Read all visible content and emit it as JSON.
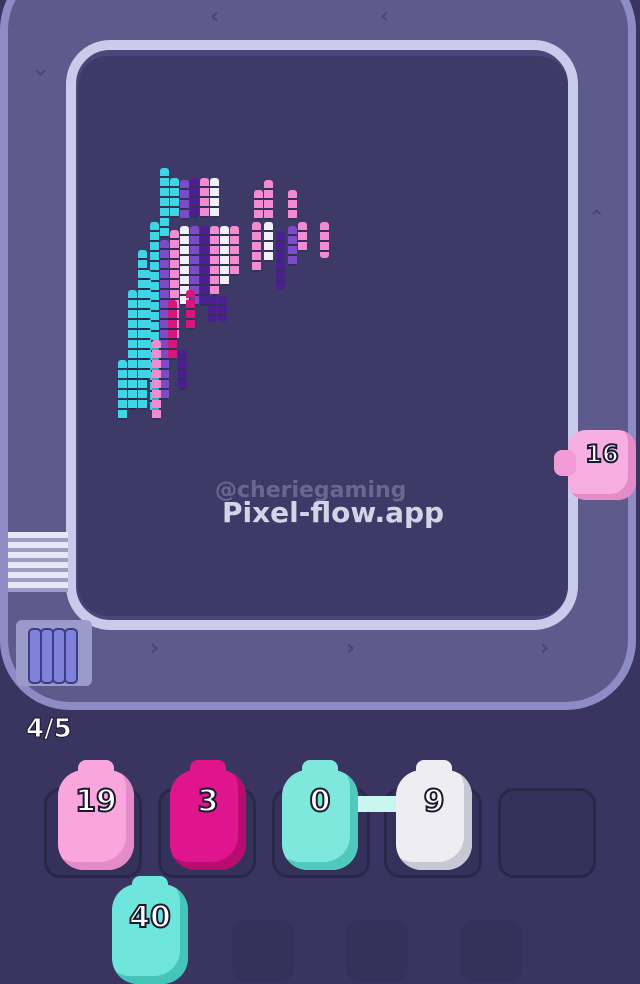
{
  "watermark": {
    "handle": "@cheriegaming",
    "site": "Pixel-flow.app"
  },
  "queue_counter": "4/5",
  "track_pig": {
    "value": "16",
    "color": "#f7aee0"
  },
  "slot_pigs": [
    {
      "value": "19",
      "color": "#f8a6dc"
    },
    {
      "value": "3",
      "color": "#e0148c"
    },
    {
      "value": "0",
      "color": "#7ee8dc"
    },
    {
      "value": "9",
      "color": "#eeeef2"
    },
    {
      "value": "",
      "color": ""
    }
  ],
  "waiting_pig": {
    "value": "40",
    "color": "#6ee6dc"
  },
  "colors": {
    "cyan": "#3ed6e6",
    "pink": "#f28bd0",
    "magenta": "#d6187d",
    "purple": "#4b1f8f",
    "violet": "#7b4bc8",
    "white": "#f1f0f6"
  }
}
